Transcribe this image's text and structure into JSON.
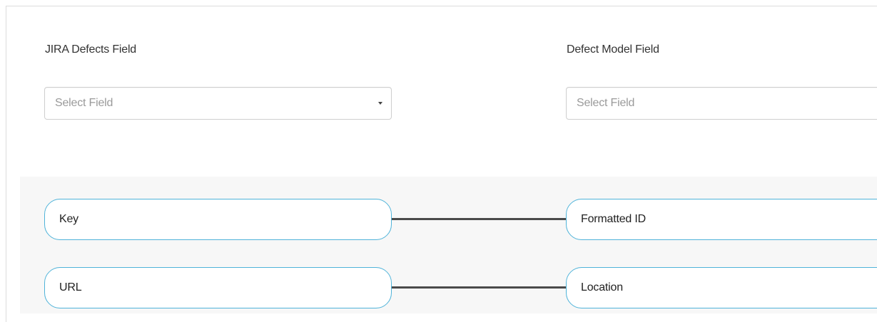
{
  "left_column": {
    "heading": "JIRA Defects Field",
    "select": {
      "placeholder": "Select Field"
    }
  },
  "right_column": {
    "heading": "Defect Model Field",
    "select": {
      "placeholder": "Select Field"
    }
  },
  "mappings": [
    {
      "source": "Key",
      "target": "Formatted ID"
    },
    {
      "source": "URL",
      "target": "Location"
    }
  ],
  "colors": {
    "pill_border": "#4fb3d9",
    "connector": "#4a4a4a",
    "panel_background": "#f7f7f7"
  }
}
